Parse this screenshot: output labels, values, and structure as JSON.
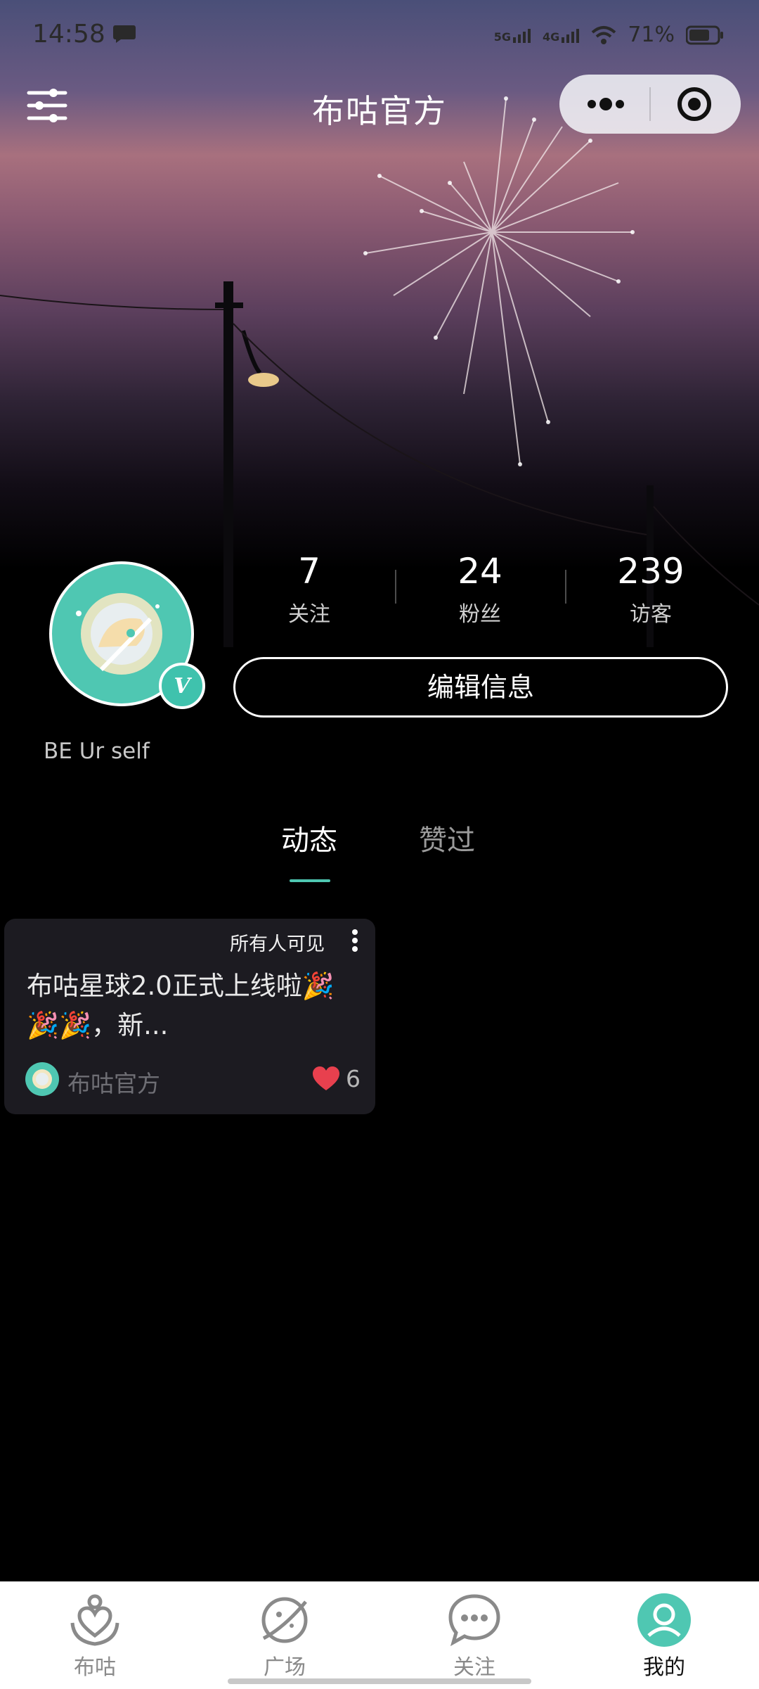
{
  "status_bar": {
    "time": "14:58",
    "network_1": "5G",
    "network_2": "4G",
    "battery": "71%"
  },
  "header": {
    "title": "布咕官方",
    "menu_icon": "sliders-icon",
    "more_icon": "more-dots-icon",
    "close_icon": "target-icon"
  },
  "profile": {
    "verified_badge": "V",
    "bio": "BE Ur self",
    "edit_button": "编辑信息",
    "stats": [
      {
        "value": "7",
        "label": "关注"
      },
      {
        "value": "24",
        "label": "粉丝"
      },
      {
        "value": "239",
        "label": "访客"
      }
    ]
  },
  "tabs": [
    {
      "label": "动态",
      "active": true
    },
    {
      "label": "赞过",
      "active": false
    }
  ],
  "posts": [
    {
      "visibility": "所有人可见",
      "text": "布咕星球2.0正式上线啦🎉🎉🎉，新...",
      "author": "布咕官方",
      "likes": "6"
    }
  ],
  "bottom_nav": [
    {
      "label": "布咕",
      "icon": "heart-hands-icon",
      "active": false
    },
    {
      "label": "广场",
      "icon": "planet-icon",
      "active": false
    },
    {
      "label": "关注",
      "icon": "chat-bubble-icon",
      "active": false
    },
    {
      "label": "我的",
      "icon": "user-icon",
      "active": true
    }
  ],
  "colors": {
    "accent": "#4fc7b2",
    "background": "#000000",
    "card": "#1c1b21",
    "like": "#e8404e"
  }
}
